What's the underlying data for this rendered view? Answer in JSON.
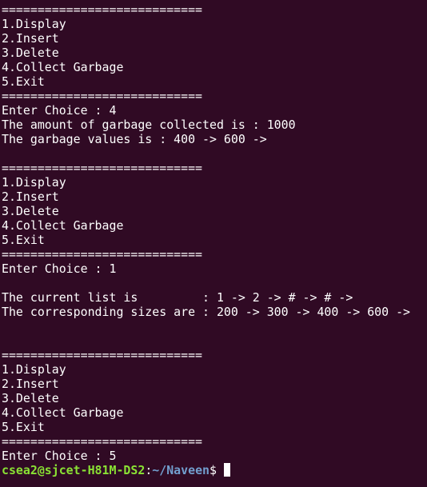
{
  "terminal": {
    "lines": [
      "============================",
      "1.Display",
      "2.Insert",
      "3.Delete",
      "4.Collect Garbage",
      "5.Exit",
      "============================",
      "Enter Choice : 4",
      "The amount of garbage collected is : 1000",
      "The garbage values is : 400 -> 600 ->",
      "",
      "============================",
      "1.Display",
      "2.Insert",
      "3.Delete",
      "4.Collect Garbage",
      "5.Exit",
      "============================",
      "Enter Choice : 1",
      "",
      "The current list is         : 1 -> 2 -> # -> # ->",
      "The corresponding sizes are : 200 -> 300 -> 400 -> 600 ->",
      "",
      "",
      "============================",
      "1.Display",
      "2.Insert",
      "3.Delete",
      "4.Collect Garbage",
      "5.Exit",
      "============================",
      "Enter Choice : 5"
    ],
    "prompt": {
      "user_host": "csea2@sjcet-H81M-DS2",
      "separator": ":",
      "path": "~/Naveen",
      "symbol": "$"
    },
    "colors": {
      "background": "#300a24",
      "text": "#ffffff",
      "user_host": "#8ae234",
      "path": "#729fcf"
    }
  }
}
